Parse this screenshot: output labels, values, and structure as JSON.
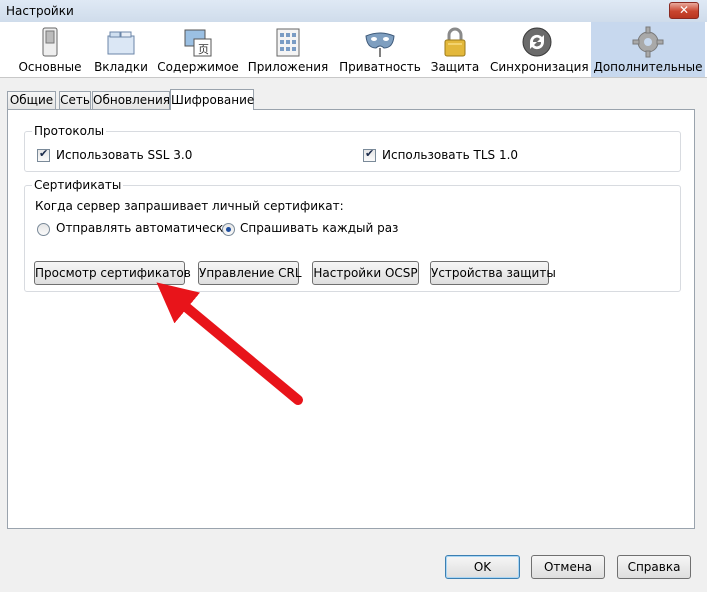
{
  "window": {
    "title": "Настройки",
    "close_label": "✕"
  },
  "toolbar": {
    "items": [
      {
        "label": "Основные",
        "icon": "switch-icon"
      },
      {
        "label": "Вкладки",
        "icon": "tabs-icon"
      },
      {
        "label": "Содержимое",
        "icon": "content-icon"
      },
      {
        "label": "Приложения",
        "icon": "applications-icon"
      },
      {
        "label": "Приватность",
        "icon": "mask-icon"
      },
      {
        "label": "Защита",
        "icon": "padlock-icon"
      },
      {
        "label": "Синхронизация",
        "icon": "sync-icon"
      },
      {
        "label": "Дополнительные",
        "icon": "gear-icon"
      }
    ]
  },
  "subtabs": {
    "items": [
      "Общие",
      "Сеть",
      "Обновления",
      "Шифрование"
    ]
  },
  "protocols": {
    "legend": "Протоколы",
    "ssl_label": "Использовать SSL 3.0",
    "tls_label": "Использовать TLS 1.0"
  },
  "certificates": {
    "legend": "Сертификаты",
    "question": "Когда сервер запрашивает личный сертификат:",
    "auto_label": "Отправлять автоматически",
    "ask_label": "Спрашивать каждый раз",
    "view_button": "Просмотр сертификатов",
    "crl_button": "Управление CRL",
    "ocsp_button": "Настройки OCSP",
    "devices_button": "Устройства защиты"
  },
  "footer": {
    "ok": "OK",
    "cancel": "Отмена",
    "help": "Справка"
  },
  "colors": {
    "arrow": "#e8141a",
    "active_tab": "#c7d8ee"
  }
}
